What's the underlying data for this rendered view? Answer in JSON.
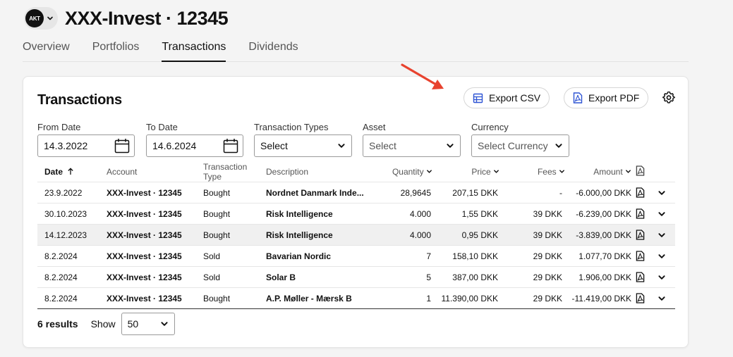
{
  "header": {
    "avatar_text": "AKT",
    "title": "XXX-Invest · 12345"
  },
  "tabs": [
    {
      "label": "Overview",
      "active": false
    },
    {
      "label": "Portfolios",
      "active": false
    },
    {
      "label": "Transactions",
      "active": true
    },
    {
      "label": "Dividends",
      "active": false
    }
  ],
  "card": {
    "title": "Transactions",
    "export_csv_label": "Export CSV",
    "export_pdf_label": "Export PDF"
  },
  "filters": {
    "from_date": {
      "label": "From Date",
      "value": "14.3.2022"
    },
    "to_date": {
      "label": "To Date",
      "value": "14.6.2024"
    },
    "transaction_types": {
      "label": "Transaction Types",
      "value": "Select"
    },
    "asset": {
      "label": "Asset",
      "placeholder": "Select"
    },
    "currency": {
      "label": "Currency",
      "placeholder": "Select Currency"
    }
  },
  "table": {
    "columns": {
      "date": "Date",
      "account": "Account",
      "type": "Transaction Type",
      "description": "Description",
      "quantity": "Quantity",
      "price": "Price",
      "fees": "Fees",
      "amount": "Amount"
    },
    "rows": [
      {
        "date": "23.9.2022",
        "account": "XXX-Invest · 12345",
        "type": "Bought",
        "description": "Nordnet Danmark Inde...",
        "quantity": "28,9645",
        "price": "207,15 DKK",
        "fees": "-",
        "amount": "-6.000,00 DKK"
      },
      {
        "date": "30.10.2023",
        "account": "XXX-Invest · 12345",
        "type": "Bought",
        "description": "Risk Intelligence",
        "quantity": "4.000",
        "price": "1,55 DKK",
        "fees": "39 DKK",
        "amount": "-6.239,00 DKK"
      },
      {
        "date": "14.12.2023",
        "account": "XXX-Invest · 12345",
        "type": "Bought",
        "description": "Risk Intelligence",
        "quantity": "4.000",
        "price": "0,95 DKK",
        "fees": "39 DKK",
        "amount": "-3.839,00 DKK"
      },
      {
        "date": "8.2.2024",
        "account": "XXX-Invest · 12345",
        "type": "Sold",
        "description": "Bavarian Nordic",
        "quantity": "7",
        "price": "158,10 DKK",
        "fees": "29 DKK",
        "amount": "1.077,70 DKK"
      },
      {
        "date": "8.2.2024",
        "account": "XXX-Invest · 12345",
        "type": "Sold",
        "description": "Solar B",
        "quantity": "5",
        "price": "387,00 DKK",
        "fees": "29 DKK",
        "amount": "1.906,00 DKK"
      },
      {
        "date": "8.2.2024",
        "account": "XXX-Invest · 12345",
        "type": "Bought",
        "description": "A.P. Møller - Mærsk B",
        "quantity": "1",
        "price": "11.390,00 DKK",
        "fees": "29 DKK",
        "amount": "-11.419,00 DKK"
      }
    ]
  },
  "footer": {
    "results": "6 results",
    "show_label": "Show",
    "page_size": "50"
  },
  "colors": {
    "accent_blue": "#2f55d4",
    "annotation_arrow": "#e8432f",
    "text": "#111111"
  },
  "icons": [
    "chevron-down-icon",
    "calendar-icon",
    "spreadsheet-icon",
    "pdf-icon",
    "gear-icon",
    "sort-up-icon",
    "arrow-annotation"
  ]
}
